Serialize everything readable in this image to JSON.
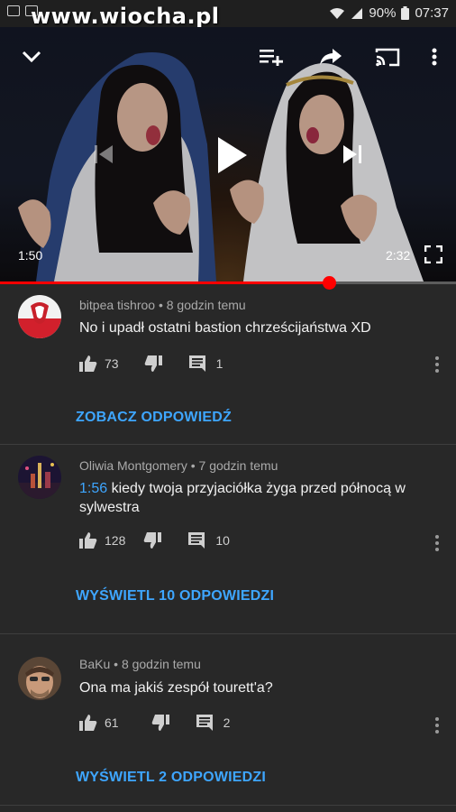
{
  "status": {
    "watermark": "www.wiocha.pl",
    "battery": "90%",
    "time": "07:37"
  },
  "player": {
    "current_time": "1:50",
    "duration": "2:32",
    "progress": 0.724
  },
  "comments": [
    {
      "author": "bitpea tishroo",
      "age": "8 godzin temu",
      "timestamp_link": "",
      "text": "No i upadł ostatni bastion chrześcijaństwa XD",
      "likes": "73",
      "replies": "1",
      "replies_label": "ZOBACZ ODPOWIEDŹ"
    },
    {
      "author": "Oliwia Montgomery",
      "age": "7 godzin temu",
      "timestamp_link": "1:56",
      "text": "kiedy twoja przyjaciółka żyga przed północą w sylwestra",
      "likes": "128",
      "replies": "10",
      "replies_label": "WYŚWIETL 10 ODPOWIEDZI"
    },
    {
      "author": "BaKu",
      "age": "8 godzin temu",
      "timestamp_link": "",
      "text": "Ona ma jakiś zespół tourett'a?",
      "likes": "61",
      "replies": "2",
      "replies_label": "WYŚWIETL 2 ODPOWIEDZI"
    }
  ],
  "colors": {
    "background": "#282828",
    "accent_blue": "#3ea6ff",
    "progress_red": "#ff0000"
  },
  "icons": [
    "minimize-chevron-icon",
    "add-to-queue-icon",
    "share-icon",
    "cast-icon",
    "more-vert-icon",
    "previous-icon",
    "play-icon",
    "next-icon",
    "fullscreen-icon",
    "like-icon",
    "dislike-icon",
    "reply-icon"
  ]
}
